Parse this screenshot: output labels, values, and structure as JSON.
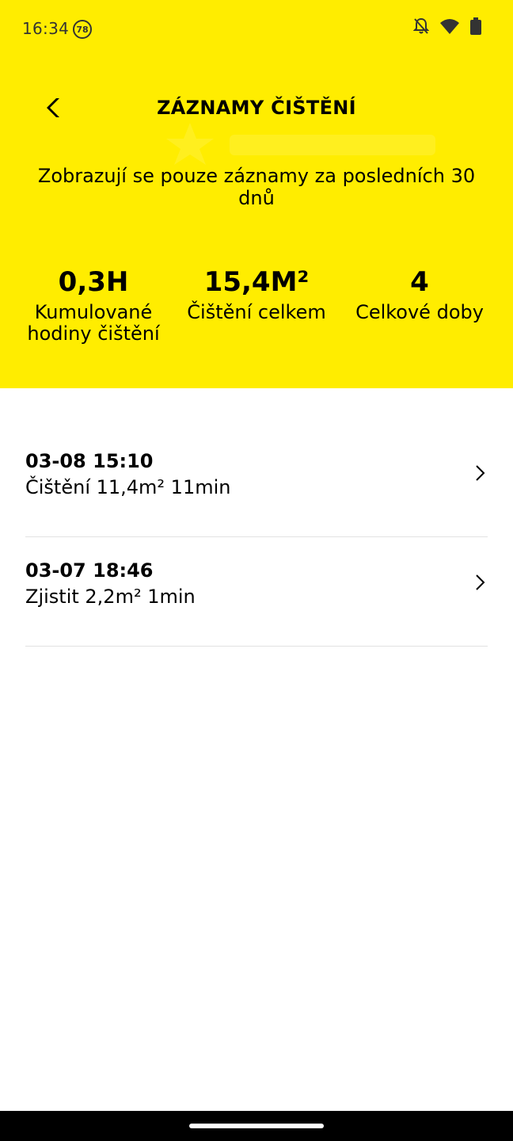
{
  "status_bar": {
    "time": "16:34",
    "notification_count": "78",
    "icons": [
      "bell-off-icon",
      "wifi-icon",
      "battery-icon"
    ]
  },
  "header": {
    "title": "ZÁZNAMY ČIŠTĚNÍ",
    "info": "Zobrazují se pouze záznamy za posledních 30 dnů",
    "background_color": "#FFED00"
  },
  "stats": [
    {
      "value": "0,3H",
      "label": "Kumulované hodiny čištění"
    },
    {
      "value": "15,4M²",
      "label": "Čištění celkem"
    },
    {
      "value": "4",
      "label": "Celkové doby"
    }
  ],
  "records": [
    {
      "date": "03-08 15:10",
      "summary": "Čištění 11,4m² 11min"
    },
    {
      "date": "03-07 18:46",
      "summary": "Zjistit 2,2m² 1min"
    }
  ]
}
